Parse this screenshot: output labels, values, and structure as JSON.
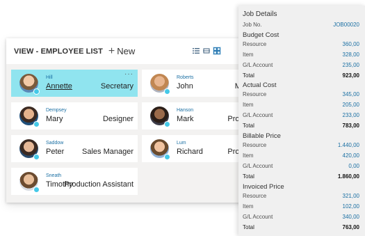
{
  "list": {
    "title": "VIEW - EMPLOYEE LIST",
    "new_label": "New",
    "view_icons": [
      "list-view-icon",
      "tall-tiles-view-icon",
      "tiles-view-icon"
    ]
  },
  "employees": [
    {
      "surname": "Hill",
      "first": "Annette",
      "title": "Secretary",
      "selected": true
    },
    {
      "surname": "Roberts",
      "first": "John",
      "title": "Managin"
    },
    {
      "surname": "Dempsey",
      "first": "Mary",
      "title": "Designer"
    },
    {
      "surname": "Hanson",
      "first": "Mark",
      "title": "Production"
    },
    {
      "surname": "Saddow",
      "first": "Peter",
      "title": "Sales Manager"
    },
    {
      "surname": "Lum",
      "first": "Richard",
      "title": "Production"
    },
    {
      "surname": "Sneath",
      "first": "Timothy",
      "title": "Production Assistant"
    }
  ],
  "job": {
    "title": "Job Details",
    "job_no_label": "Job No.",
    "job_no": "JOB00020",
    "sections": [
      {
        "name": "Budget Cost",
        "rows": [
          {
            "label": "Resource",
            "value": "360,00"
          },
          {
            "label": "Item",
            "value": "328,00"
          },
          {
            "label": "G/L Account",
            "value": "235,00"
          },
          {
            "label": "Total",
            "value": "923,00"
          }
        ]
      },
      {
        "name": "Actual Cost",
        "rows": [
          {
            "label": "Resource",
            "value": "345,00"
          },
          {
            "label": "Item",
            "value": "205,00"
          },
          {
            "label": "G/L Account",
            "value": "233,00"
          },
          {
            "label": "Total",
            "value": "783,00"
          }
        ]
      },
      {
        "name": "Billable Price",
        "rows": [
          {
            "label": "Resource",
            "value": "1.440,00"
          },
          {
            "label": "Item",
            "value": "420,00"
          },
          {
            "label": "G/L Account",
            "value": "0,00"
          },
          {
            "label": "Total",
            "value": "1.860,00"
          }
        ]
      },
      {
        "name": "Invoiced Price",
        "rows": [
          {
            "label": "Resource",
            "value": "321,00"
          },
          {
            "label": "Item",
            "value": "102,00"
          },
          {
            "label": "G/L Account",
            "value": "340,00"
          },
          {
            "label": "Total",
            "value": "763,00"
          }
        ]
      }
    ]
  }
}
